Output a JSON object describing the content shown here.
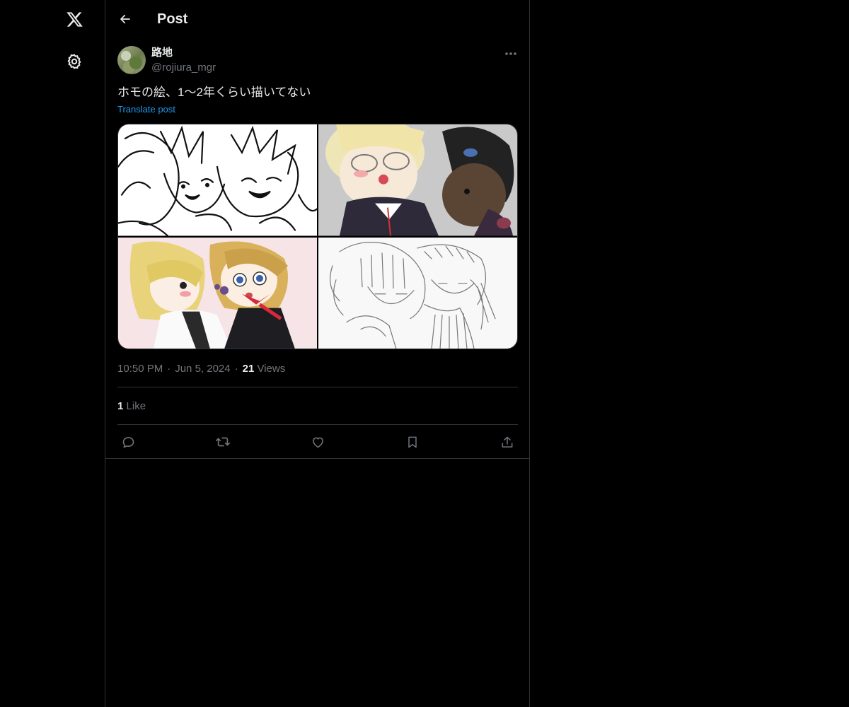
{
  "nav": {
    "logo_icon": "x-logo-icon",
    "settings_icon": "gear-icon"
  },
  "header": {
    "title": "Post"
  },
  "post": {
    "author": {
      "display_name": "路地",
      "handle": "@rojiura_mgr"
    },
    "text": "ホモの絵、1〜2年くらい描いてない",
    "translate_label": "Translate post",
    "media": [
      {
        "name": "illustration-1",
        "style": "black-and-white line art"
      },
      {
        "name": "illustration-2",
        "style": "color on gray"
      },
      {
        "name": "illustration-3",
        "style": "color on pink"
      },
      {
        "name": "illustration-4",
        "style": "pencil sketch"
      }
    ],
    "time": "10:50 PM",
    "date": "Jun 5, 2024",
    "views_count": "21",
    "views_label": "Views",
    "likes_count": "1",
    "likes_label": "Like"
  },
  "actions": [
    {
      "name": "reply-icon"
    },
    {
      "name": "repost-icon"
    },
    {
      "name": "like-icon"
    },
    {
      "name": "bookmark-icon"
    },
    {
      "name": "share-icon"
    }
  ],
  "colors": {
    "background": "#000000",
    "text": "#e7e9ea",
    "secondary_text": "#71767b",
    "link": "#1d9bf0",
    "border": "#2f3336"
  }
}
